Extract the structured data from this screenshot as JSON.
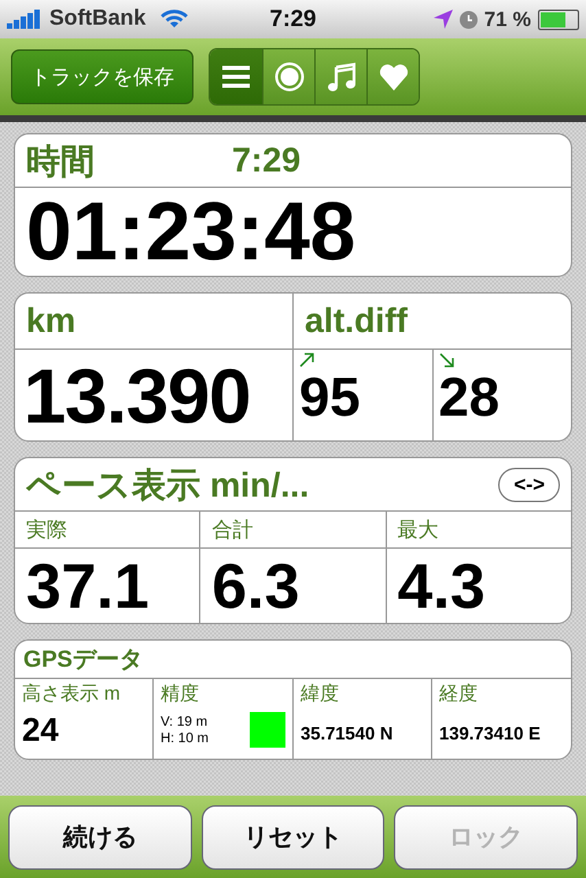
{
  "status_bar": {
    "carrier": "SoftBank",
    "time": "7:29",
    "battery": "71 %"
  },
  "toolbar": {
    "save_button": "トラックを保存",
    "tabs": [
      {
        "kind": "list",
        "selected": true
      },
      {
        "kind": "record",
        "selected": false
      },
      {
        "kind": "music",
        "selected": false
      },
      {
        "kind": "heart",
        "selected": false
      }
    ]
  },
  "time_card": {
    "label": "時間",
    "clock": "7:29",
    "value": "01:23:48"
  },
  "distance_card": {
    "label": "km",
    "value": "13.390",
    "alt_label": "alt.diff",
    "ascent": "95",
    "descent": "28"
  },
  "pace_card": {
    "title": "ペース表示 min/...",
    "toggle": "<->",
    "columns": [
      {
        "label": "実際",
        "value": "37.1"
      },
      {
        "label": "合計",
        "value": "6.3"
      },
      {
        "label": "最大",
        "value": "4.3"
      }
    ]
  },
  "gps_card": {
    "title": "GPSデータ",
    "altitude_label": "高さ表示 m",
    "altitude": "24",
    "accuracy_label": "精度",
    "vertical": "V: 19 m",
    "horizontal": "H: 10 m",
    "latitude_label": "緯度",
    "latitude": "35.71540 N",
    "longitude_label": "経度",
    "longitude": "139.73410 E"
  },
  "buttons": [
    {
      "label": "続ける",
      "disabled": false
    },
    {
      "label": "リセット",
      "disabled": false
    },
    {
      "label": "ロック",
      "disabled": true
    }
  ]
}
